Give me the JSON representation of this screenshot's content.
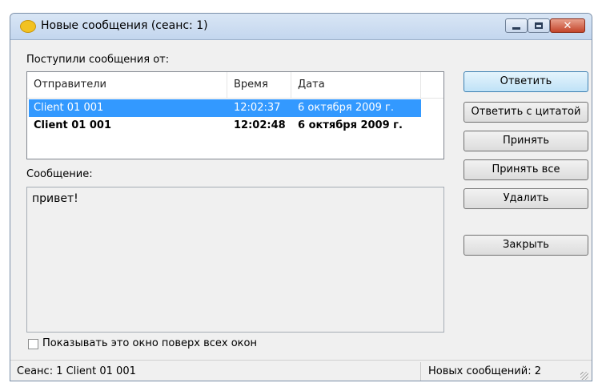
{
  "window": {
    "title": "Новые сообщения (сеанс: 1)",
    "controls": {
      "minimize_icon": "minimize-icon",
      "maximize_icon": "maximize-icon",
      "close_icon": "close-icon",
      "close_glyph": "✕"
    }
  },
  "senders": {
    "label": "Поступили сообщения от:",
    "columns": [
      "Отправители",
      "Время",
      "Дата"
    ],
    "rows": [
      {
        "sender": "Client 01 001",
        "time": "12:02:37",
        "date": "6 октября 2009 г.",
        "selected": true,
        "unread": false
      },
      {
        "sender": "Client 01 001",
        "time": "12:02:48",
        "date": "6 октября 2009 г.",
        "selected": false,
        "unread": true
      }
    ]
  },
  "message": {
    "label": "Сообщение:",
    "text": "привет!"
  },
  "checkbox": {
    "label": "Показывать это окно поверх всех окон",
    "checked": false
  },
  "buttons": {
    "reply": "Ответить",
    "reply_quote": "Ответить с цитатой",
    "accept": "Принять",
    "accept_all": "Принять все",
    "delete": "Удалить",
    "close": "Закрыть"
  },
  "status": {
    "left": "Сеанс: 1  Client 01 001",
    "right": "Новых сообщений: 2"
  },
  "colors": {
    "selection": "#3399ff",
    "window_bg": "#f0f0f0",
    "default_button": "#bfe2f7"
  }
}
